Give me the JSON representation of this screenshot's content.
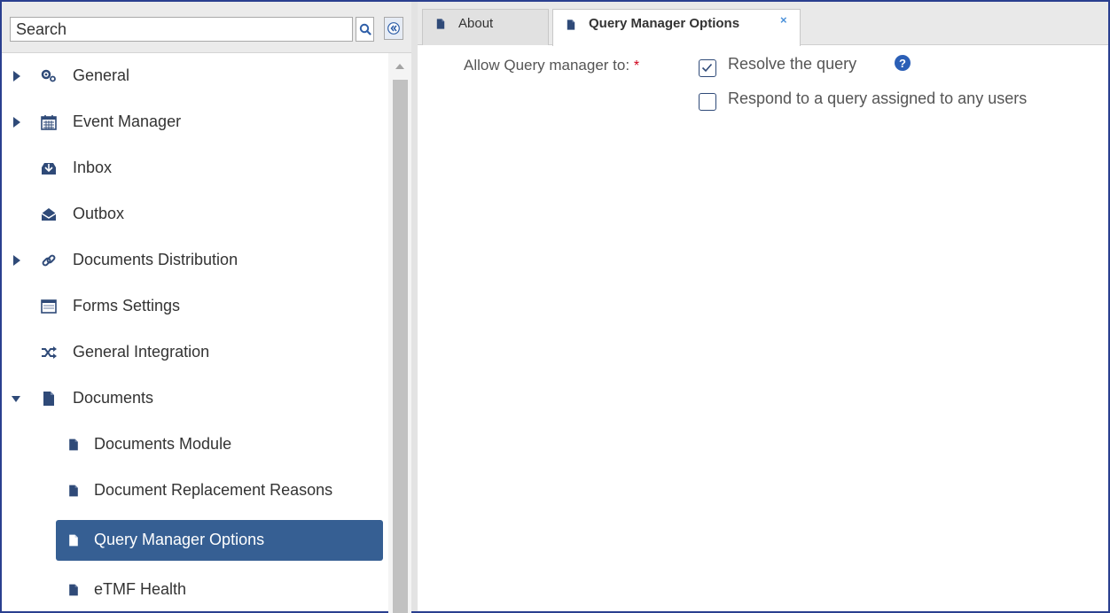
{
  "search": {
    "placeholder": "Search"
  },
  "tree": [
    {
      "label": "General",
      "icon": "gears-icon",
      "expandable": true,
      "expanded": false
    },
    {
      "label": "Event Manager",
      "icon": "calendar-icon",
      "expandable": true,
      "expanded": false
    },
    {
      "label": "Inbox",
      "icon": "inbox-icon",
      "expandable": false
    },
    {
      "label": "Outbox",
      "icon": "outbox-icon",
      "expandable": false
    },
    {
      "label": "Documents Distribution",
      "icon": "link-icon",
      "expandable": true,
      "expanded": false
    },
    {
      "label": "Forms Settings",
      "icon": "form-icon",
      "expandable": false
    },
    {
      "label": "General Integration",
      "icon": "shuffle-icon",
      "expandable": false
    },
    {
      "label": "Documents",
      "icon": "document-icon",
      "expandable": true,
      "expanded": true
    },
    {
      "label": "Documents Module",
      "icon": "document-icon",
      "child": true
    },
    {
      "label": "Document Replacement Reasons",
      "icon": "document-icon",
      "child": true
    },
    {
      "label": "Query Manager Options",
      "icon": "document-icon",
      "child": true,
      "selected": true
    },
    {
      "label": "eTMF Health",
      "icon": "document-icon",
      "child": true
    }
  ],
  "tabs": [
    {
      "label": "About",
      "icon": "document-icon",
      "active": false
    },
    {
      "label": "Query Manager Options",
      "icon": "document-icon",
      "active": true,
      "close": "×"
    }
  ],
  "form": {
    "label": "Allow Query manager to:",
    "required_mark": "*",
    "options": [
      {
        "label": "Resolve the query",
        "checked": true,
        "help": "?"
      },
      {
        "label": "Respond to a query assigned to any users",
        "checked": false
      }
    ]
  },
  "colors": {
    "frame": "#2a3f8f",
    "selected_bg": "#365f93",
    "help_icon": "#2b5fb6",
    "required": "#d0021b"
  }
}
